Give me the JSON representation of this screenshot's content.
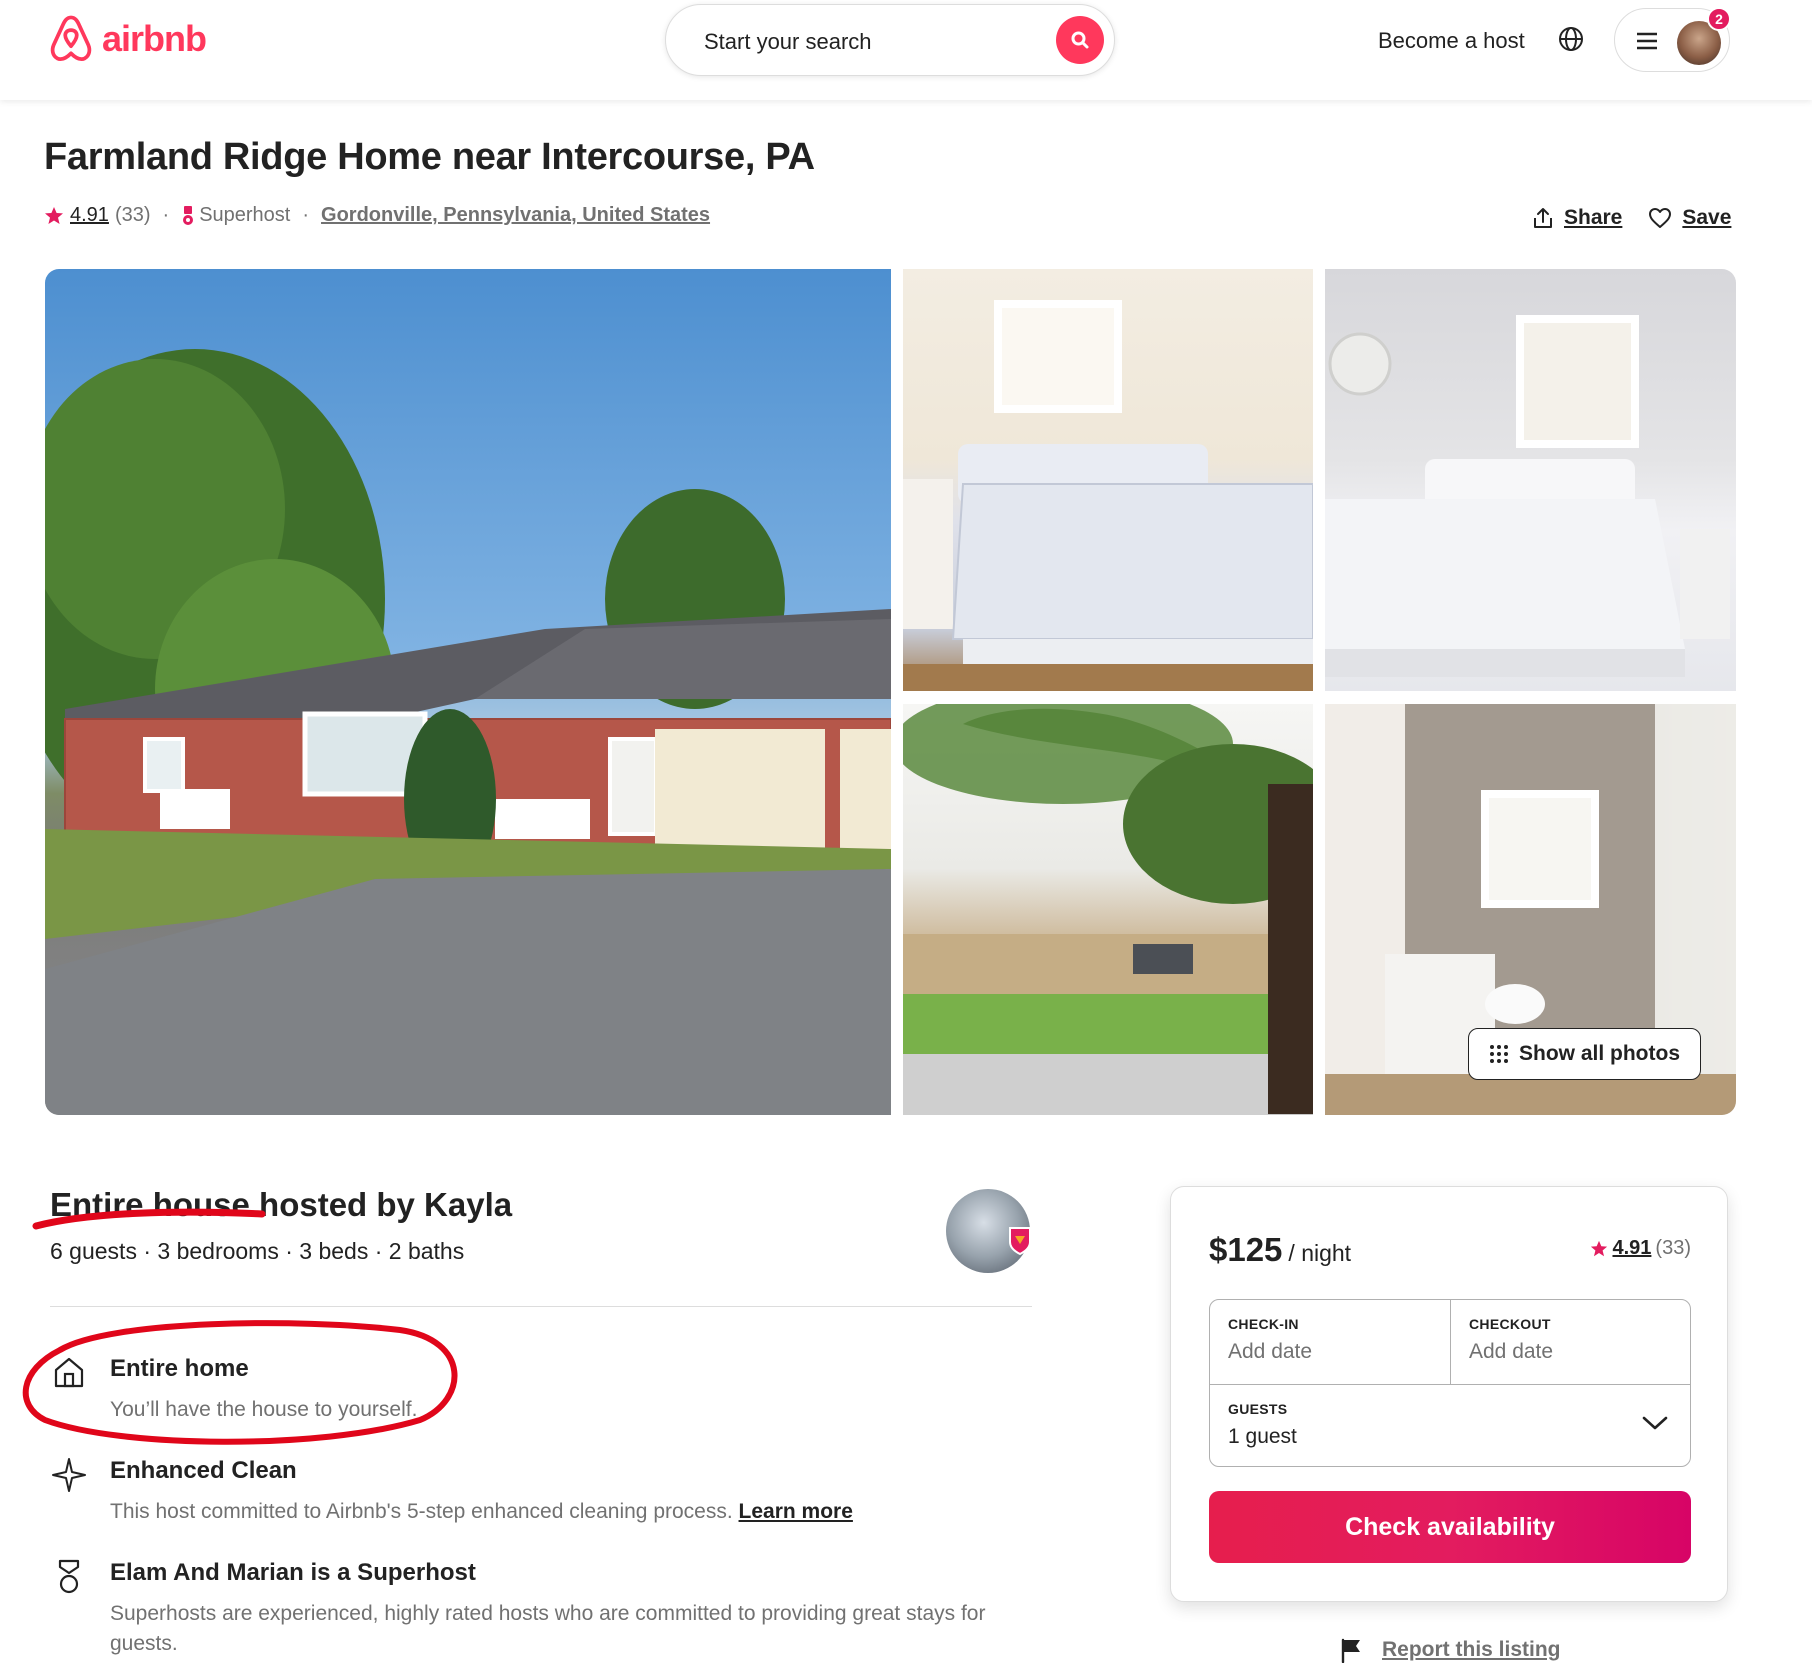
{
  "header": {
    "logo_text": "airbnb",
    "search_placeholder": "Start your search",
    "become_host": "Become a host",
    "notification_count": "2"
  },
  "listing": {
    "title": "Farmland Ridge Home near Intercourse, PA",
    "rating": "4.91",
    "review_count": "(33)",
    "superhost_label": "Superhost",
    "location": "Gordonville, Pennsylvania, United States",
    "share_label": "Share",
    "save_label": "Save",
    "show_all_photos": "Show all photos"
  },
  "host": {
    "hosted_by": "Entire house hosted by Kayla",
    "details": "6 guests · 3 bedrooms · 3 beds · 2 baths"
  },
  "features": [
    {
      "icon": "home-icon",
      "title": "Entire home",
      "desc": "You’ll have the house to yourself."
    },
    {
      "icon": "sparkle-icon",
      "title": "Enhanced Clean",
      "desc": "This host committed to Airbnb's 5-step enhanced cleaning process.",
      "link": "Learn more"
    },
    {
      "icon": "superhost-icon",
      "title": "Elam And Marian is a Superhost",
      "desc": "Superhosts are experienced, highly rated hosts who are committed to providing great stays for guests."
    }
  ],
  "booking": {
    "price": "$125",
    "per_night": "/ night",
    "rating": "4.91",
    "review_count": "(33)",
    "checkin_label": "CHECK-IN",
    "checkin_value": "Add date",
    "checkout_label": "CHECKOUT",
    "checkout_value": "Add date",
    "guests_label": "GUESTS",
    "guests_value": "1 guest",
    "cta": "Check availability",
    "report": "Report this listing"
  },
  "colors": {
    "brand": "#ff385c",
    "annotation": "#e0061a"
  }
}
